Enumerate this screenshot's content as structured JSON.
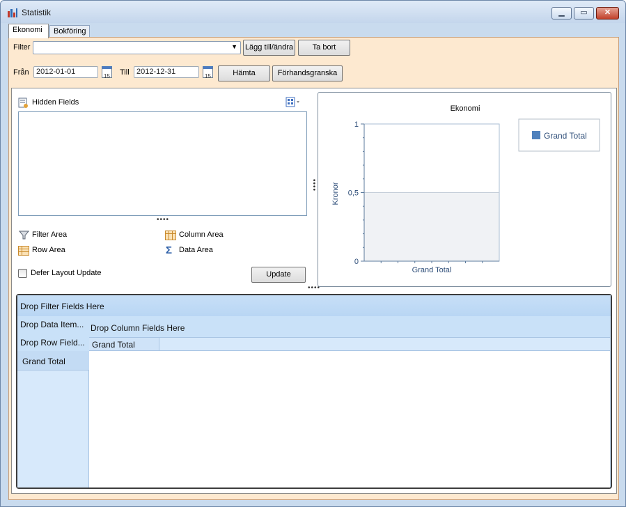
{
  "window": {
    "title": "Statistik",
    "min_glyph": "▁",
    "max_glyph": "▭",
    "close_glyph": "✕"
  },
  "tabs": [
    {
      "label": "Ekonomi",
      "active": true
    },
    {
      "label": "Bokföring",
      "active": false
    }
  ],
  "toolbar": {
    "filter_label": "Filter",
    "filter_value": "",
    "add_edit_label": "Lägg till/ändra",
    "remove_label": "Ta bort",
    "from_label": "Från",
    "from_value": "2012-01-01",
    "to_label": "Till",
    "to_value": "2012-12-31",
    "calendar_day": "15",
    "fetch_label": "Hämta",
    "preview_label": "Förhandsgranska"
  },
  "customization": {
    "hidden_fields_label": "Hidden Fields",
    "filter_area_label": "Filter Area",
    "column_area_label": "Column Area",
    "row_area_label": "Row Area",
    "data_area_label": "Data Area",
    "defer_label": "Defer Layout Update",
    "defer_checked": false,
    "update_label": "Update"
  },
  "chart_data": {
    "type": "bar",
    "title": "Ekonomi",
    "categories": [
      "Grand Total"
    ],
    "series": [
      {
        "name": "Grand Total",
        "values": [
          0
        ]
      }
    ],
    "xlabel": "",
    "ylabel": "Kronor",
    "ylim": [
      0,
      1
    ],
    "yticks": [
      "0",
      "0,5",
      "1"
    ],
    "legend": "right",
    "colors": {
      "series": "#4f81bd",
      "band": "#f0f2f5",
      "axis": "#5b7a9c"
    }
  },
  "grid": {
    "drop_filter": "Drop Filter Fields Here",
    "drop_data": "Drop Data Item...",
    "drop_column": "Drop Column Fields Here",
    "drop_row": "Drop Row Field...",
    "column_grand_total": "Grand Total",
    "row_grand_total": "Grand Total"
  }
}
